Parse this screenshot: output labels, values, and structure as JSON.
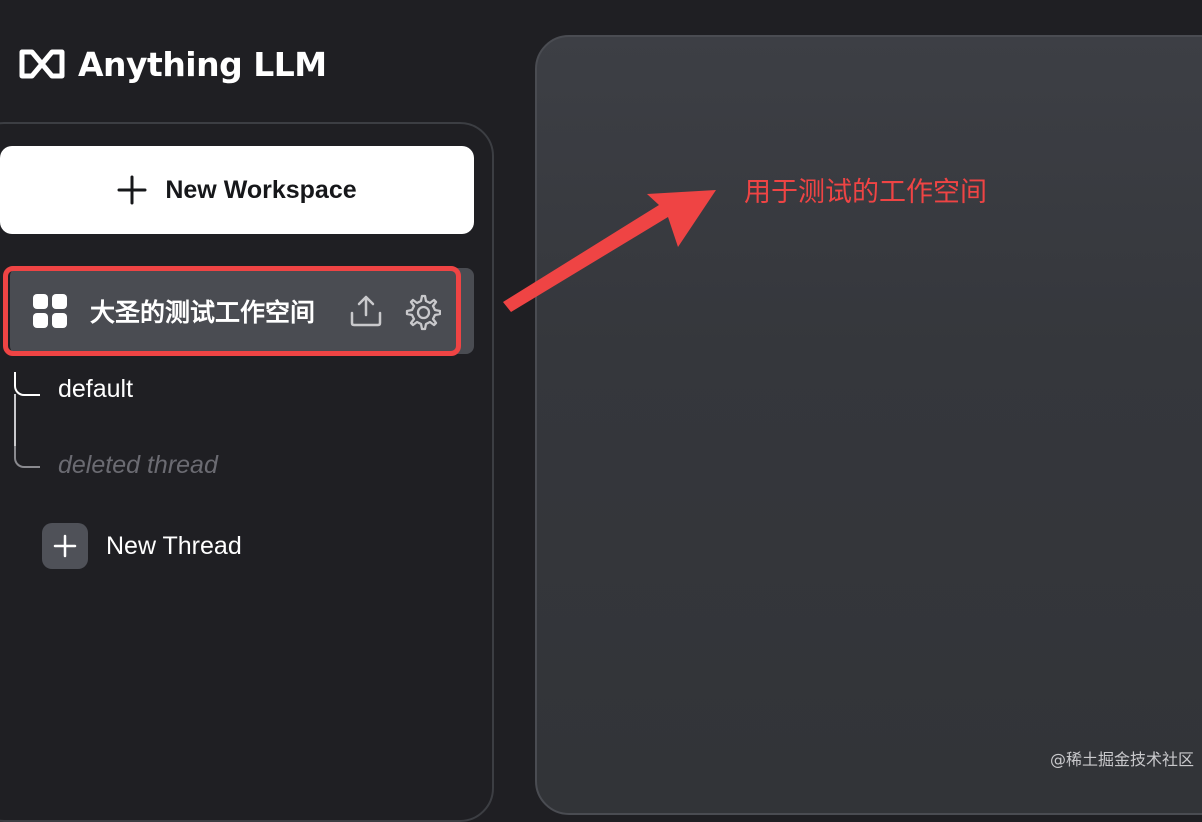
{
  "app": {
    "title": "Anything LLM"
  },
  "sidebar": {
    "new_workspace_label": "New Workspace",
    "workspace": {
      "name": "大圣的测试工作空间",
      "threads": [
        {
          "label": "default"
        },
        {
          "label": "deleted thread"
        }
      ]
    },
    "new_thread_label": "New Thread"
  },
  "annotation": {
    "text": "用于测试的工作空间",
    "color": "#ef4444"
  },
  "watermark": "@稀土掘金技术社区",
  "icons": [
    "logo-mark-icon",
    "plus-icon",
    "grid-icon",
    "upload-icon",
    "gear-icon",
    "arrow-annotation-icon"
  ],
  "colors": {
    "background": "#1f1f23",
    "accent_red": "#ef4444",
    "button_white": "#ffffff",
    "active_item": "#4a4c52"
  }
}
